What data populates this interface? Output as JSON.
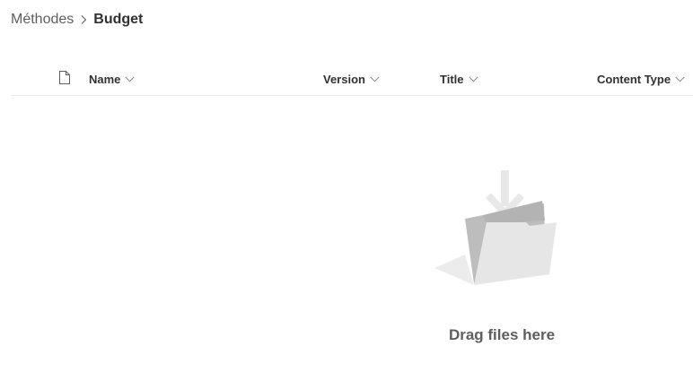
{
  "breadcrumb": {
    "parent_label": "Méthodes",
    "current_label": "Budget",
    "separator_icon": "chevron-right-icon"
  },
  "columns": {
    "file_type_icon": "document-icon",
    "name": "Name",
    "version": "Version",
    "title": "Title",
    "content_type": "Content Type",
    "sort_icon": "chevron-down-icon"
  },
  "empty_state": {
    "illustration_icon": "folder-drop-icon",
    "message": "Drag files here"
  },
  "colors": {
    "text_primary": "#323130",
    "text_secondary": "#605e5c",
    "divider": "#edebe9"
  }
}
